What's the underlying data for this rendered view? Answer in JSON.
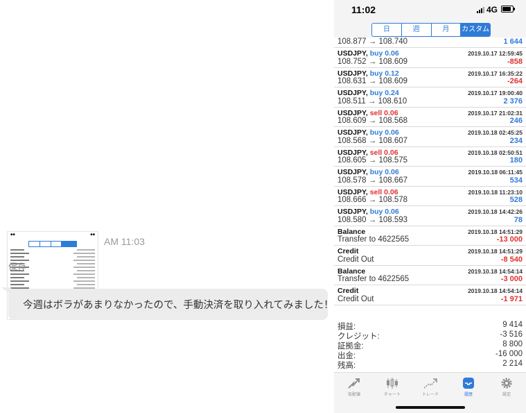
{
  "chat": {
    "timestamp": "AM 11:03",
    "save_label": "保存",
    "message": "今週はボラがあまりなかったので、手動決済を取り入れてみました！"
  },
  "phone": {
    "status_bar": {
      "time": "11:02",
      "network": "4G"
    },
    "period_tabs": [
      "日",
      "週",
      "月",
      "カスタム"
    ],
    "partial_row": {
      "prices": "108.877 → 108.740",
      "amount": "1 644"
    },
    "trades": [
      {
        "symbol": "USDJPY,",
        "side": "buy 0.06",
        "type": "buy",
        "datetime": "2019.10.17 12:59:45",
        "prices": "108.752 → 108.609",
        "amount": "-858",
        "sign": "neg"
      },
      {
        "symbol": "USDJPY,",
        "side": "buy 0.12",
        "type": "buy",
        "datetime": "2019.10.17 16:35:22",
        "prices": "108.631 → 108.609",
        "amount": "-264",
        "sign": "neg"
      },
      {
        "symbol": "USDJPY,",
        "side": "buy 0.24",
        "type": "buy",
        "datetime": "2019.10.17 19:00:40",
        "prices": "108.511 → 108.610",
        "amount": "2 376",
        "sign": "pos"
      },
      {
        "symbol": "USDJPY,",
        "side": "sell 0.06",
        "type": "sell",
        "datetime": "2019.10.17 21:02:31",
        "prices": "108.609 → 108.568",
        "amount": "246",
        "sign": "pos"
      },
      {
        "symbol": "USDJPY,",
        "side": "buy 0.06",
        "type": "buy",
        "datetime": "2019.10.18 02:45:25",
        "prices": "108.568 → 108.607",
        "amount": "234",
        "sign": "pos"
      },
      {
        "symbol": "USDJPY,",
        "side": "sell 0.06",
        "type": "sell",
        "datetime": "2019.10.18 02:50:51",
        "prices": "108.605 → 108.575",
        "amount": "180",
        "sign": "pos"
      },
      {
        "symbol": "USDJPY,",
        "side": "buy 0.06",
        "type": "buy",
        "datetime": "2019.10.18 06:11:45",
        "prices": "108.578 → 108.667",
        "amount": "534",
        "sign": "pos"
      },
      {
        "symbol": "USDJPY,",
        "side": "sell 0.06",
        "type": "sell",
        "datetime": "2019.10.18 11:23:10",
        "prices": "108.666 → 108.578",
        "amount": "528",
        "sign": "pos"
      },
      {
        "symbol": "USDJPY,",
        "side": "buy 0.06",
        "type": "buy",
        "datetime": "2019.10.18 14:42:26",
        "prices": "108.580 → 108.593",
        "amount": "78",
        "sign": "pos"
      }
    ],
    "transfers": [
      {
        "title": "Balance",
        "datetime": "2019.10.18 14:51:29",
        "desc": "Transfer to 4622565",
        "amount": "-13 000",
        "sign": "neg"
      },
      {
        "title": "Credit",
        "datetime": "2019.10.18 14:51:29",
        "desc": "Credit Out",
        "amount": "-8 540",
        "sign": "neg"
      },
      {
        "title": "Balance",
        "datetime": "2019.10.18 14:54:14",
        "desc": "Transfer to 4622565",
        "amount": "-3 000",
        "sign": "neg"
      },
      {
        "title": "Credit",
        "datetime": "2019.10.18 14:54:14",
        "desc": "Credit Out",
        "amount": "-1 971",
        "sign": "neg"
      }
    ],
    "summary": [
      {
        "label": "損益:",
        "value": "9 414"
      },
      {
        "label": "クレジット:",
        "value": "-3 516"
      },
      {
        "label": "証拠金:",
        "value": "8 800"
      },
      {
        "label": "出金:",
        "value": "-16 000"
      },
      {
        "label": "残高:",
        "value": "2 214"
      }
    ],
    "tabs": [
      {
        "label": "気配値",
        "icon": "quotes-icon"
      },
      {
        "label": "チャート",
        "icon": "chart-icon"
      },
      {
        "label": "トレード",
        "icon": "trade-icon"
      },
      {
        "label": "履歴",
        "icon": "history-icon",
        "active": true
      },
      {
        "label": "設定",
        "icon": "settings-icon"
      }
    ],
    "colors": {
      "accent": "#2f7bd8",
      "negative": "#e03131"
    }
  }
}
